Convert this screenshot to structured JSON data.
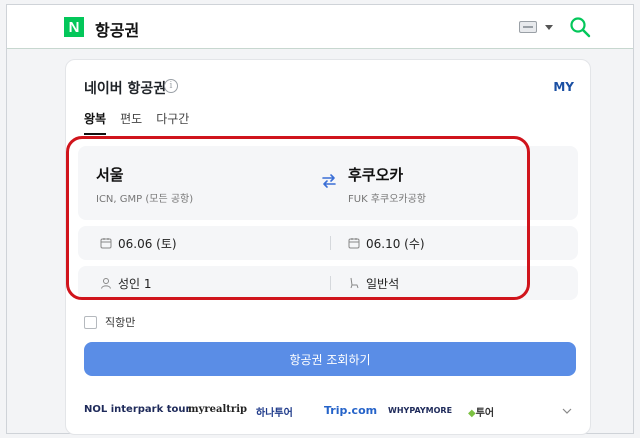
{
  "header": {
    "logo_letter": "N",
    "title": "항공권"
  },
  "card": {
    "title": "네이버 항공권",
    "info_glyph": "i",
    "my_label": "MY",
    "tabs": [
      {
        "label": "왕복",
        "active": true
      },
      {
        "label": "편도",
        "active": false
      },
      {
        "label": "다구간",
        "active": false
      }
    ]
  },
  "route": {
    "origin": {
      "city": "서울",
      "detail": "ICN, GMP (모든 공항)"
    },
    "destination": {
      "city": "후쿠오카",
      "detail": "FUK 후쿠오카공항"
    }
  },
  "dates": {
    "departure": "06.06 (토)",
    "return": "06.10 (수)"
  },
  "options": {
    "passengers": "성인 1",
    "cabin": "일반석"
  },
  "direct_only": {
    "label": "직항만",
    "checked": false
  },
  "search_button": "항공권 조회하기",
  "partners": [
    "NOL interpark tour",
    "myrealtrip",
    "하나투어",
    "Trip.com",
    "WHYPAYMORE",
    "투어"
  ],
  "colors": {
    "accent": "#5a8de6",
    "brand": "#03c75a",
    "highlight": "#d0141c"
  }
}
